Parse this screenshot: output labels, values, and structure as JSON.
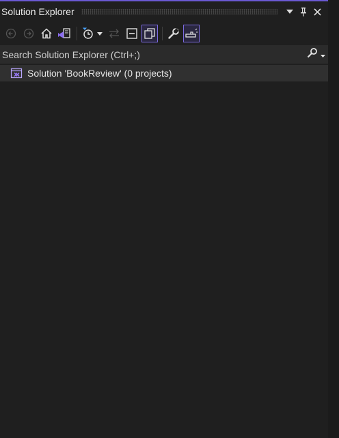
{
  "panel": {
    "title": "Solution Explorer",
    "accent_color": "#6b59d3",
    "title_buttons": [
      {
        "name": "dropdown-icon",
        "glyph": "▼"
      },
      {
        "name": "pin-icon",
        "glyph": ""
      },
      {
        "name": "close-icon",
        "glyph": "✕"
      }
    ]
  },
  "toolbar": {
    "items": [
      {
        "name": "back-icon",
        "state": "disabled"
      },
      {
        "name": "forward-icon",
        "state": "disabled"
      },
      {
        "name": "home-icon",
        "state": "normal"
      },
      {
        "name": "switch-views-icon",
        "state": "normal"
      },
      {
        "name": "pending-changes-filter-icon",
        "state": "normal"
      },
      {
        "name": "sync-with-active-document-icon",
        "state": "disabled"
      },
      {
        "name": "collapse-all-icon",
        "state": "normal"
      },
      {
        "name": "show-all-files-icon",
        "state": "active"
      },
      {
        "name": "properties-wrench-icon",
        "state": "normal"
      },
      {
        "name": "preview-selected-items-icon",
        "state": "active"
      }
    ]
  },
  "search": {
    "placeholder": "Search Solution Explorer (Ctrl+;)"
  },
  "tree": {
    "items": [
      {
        "label": "Solution 'BookReview' (0 projects)",
        "icon": "solution-icon",
        "selected": true
      }
    ]
  }
}
